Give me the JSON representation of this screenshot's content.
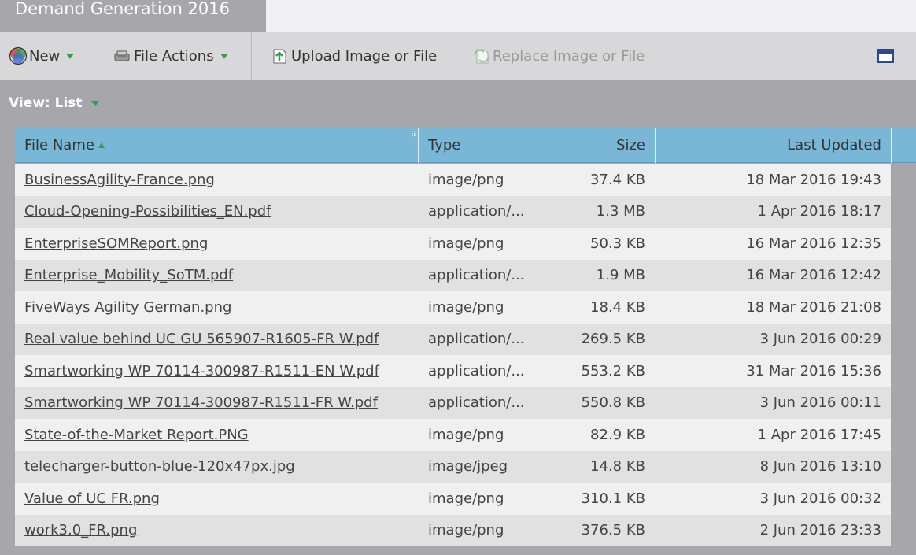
{
  "tab": {
    "title": "Demand Generation 2016"
  },
  "toolbar": {
    "new_label": "New",
    "file_actions_label": "File Actions",
    "upload_label": "Upload Image or File",
    "replace_label": "Replace Image or File"
  },
  "view": {
    "label": "View: List"
  },
  "table": {
    "headers": {
      "name": "File Name",
      "type": "Type",
      "size": "Size",
      "updated": "Last Updated"
    },
    "rows": [
      {
        "name": "BusinessAgility-France.png",
        "type": "image/png",
        "size": "37.4 KB",
        "updated": "18 Mar 2016 19:43"
      },
      {
        "name": "Cloud-Opening-Possibilities_EN.pdf",
        "type": "application/...",
        "size": "1.3 MB",
        "updated": "1 Apr 2016 18:17"
      },
      {
        "name": "EnterpriseSOMReport.png",
        "type": "image/png",
        "size": "50.3 KB",
        "updated": "16 Mar 2016 12:35"
      },
      {
        "name": "Enterprise_Mobility_SoTM.pdf",
        "type": "application/...",
        "size": "1.9 MB",
        "updated": "16 Mar 2016 12:42"
      },
      {
        "name": "FiveWays Agility German.png",
        "type": "image/png",
        "size": "18.4 KB",
        "updated": "18 Mar 2016 21:08"
      },
      {
        "name": "Real value behind UC GU 565907-R1605-FR W.pdf",
        "type": "application/...",
        "size": "269.5 KB",
        "updated": "3 Jun 2016 00:29"
      },
      {
        "name": "Smartworking WP 70114-300987-R1511-EN W.pdf",
        "type": "application/...",
        "size": "553.2 KB",
        "updated": "31 Mar 2016 15:36"
      },
      {
        "name": "Smartworking WP 70114-300987-R1511-FR W.pdf",
        "type": "application/...",
        "size": "550.8 KB",
        "updated": "3 Jun 2016 00:11"
      },
      {
        "name": "State-of-the-Market Report.PNG",
        "type": "image/png",
        "size": "82.9 KB",
        "updated": "1 Apr 2016 17:45"
      },
      {
        "name": "telecharger-button-blue-120x47px.jpg",
        "type": "image/jpeg",
        "size": "14.8 KB",
        "updated": "8 Jun 2016 13:10"
      },
      {
        "name": "Value of UC FR.png",
        "type": "image/png",
        "size": "310.1 KB",
        "updated": "3 Jun 2016 00:32"
      },
      {
        "name": "work3.0_FR.png",
        "type": "image/png",
        "size": "376.5 KB",
        "updated": "2 Jun 2016 23:33"
      }
    ]
  },
  "icons": {
    "new": "color-wheel-icon",
    "file_actions": "wrench-icon",
    "upload": "upload-file-icon",
    "replace": "replace-file-icon",
    "restore": "window-restore-icon"
  },
  "colors": {
    "header": "#7ab6d6",
    "arrow": "#3c9a4a",
    "toolbar": "#d8d8da",
    "background": "#a7a7ab"
  }
}
